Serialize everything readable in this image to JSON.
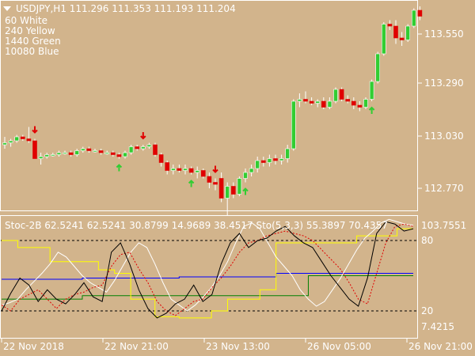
{
  "main_window": {
    "symbol_line": "USDJPY,H1  111.296 111.353 111.193 111.204",
    "legend_lines": [
      "60 White",
      "240 Yellow",
      "1440 Green",
      "10080 Blue"
    ],
    "price_ticks": [
      "113.550",
      "113.290",
      "113.030",
      "112.770"
    ]
  },
  "indicator_window": {
    "header": "Stoc-2B 62.5241 62.5241 30.8799 14.9689 38.4517  Sto(5,3,3) 55.3897 70.4357",
    "scale_top": "103.7551",
    "level_80": "80",
    "level_20": "20",
    "scale_bottom": "7.4215"
  },
  "time_axis": [
    "22 Nov 2018",
    "22 Nov 21:00",
    "23 Nov 13:00",
    "26 Nov 05:00",
    "26 Nov 21:00"
  ],
  "colors": {
    "background": "#d2b48c",
    "bull": "#32cd32",
    "bear": "#e00000",
    "wick": "#ffffff",
    "stoc_main": "#000000",
    "stoc_signal": "#e00000",
    "tf_60": "#ffffff",
    "tf_240": "#ffff00",
    "tf_1440": "#008000",
    "tf_10080": "#0000ff"
  },
  "signals": {
    "sell_arrow_icon": "red-down-arrow",
    "buy_arrow_icon": "green-up-arrow"
  },
  "chart_data": [
    {
      "type": "candlestick",
      "title": "USDJPY,H1",
      "y_ticks": [
        113.55,
        113.29,
        113.03,
        112.77
      ],
      "ylim": [
        112.62,
        113.79
      ],
      "bars": [
        {
          "o": 112.99,
          "h": 113.03,
          "l": 112.97,
          "c": 113.0
        },
        {
          "o": 113.0,
          "h": 113.02,
          "l": 112.98,
          "c": 113.01
        },
        {
          "o": 113.01,
          "h": 113.04,
          "l": 113.0,
          "c": 113.03
        },
        {
          "o": 113.03,
          "h": 113.04,
          "l": 113.01,
          "c": 113.02
        },
        {
          "o": 113.02,
          "h": 113.08,
          "l": 113.0,
          "c": 113.01
        },
        {
          "o": 113.01,
          "h": 113.02,
          "l": 112.92,
          "c": 112.92
        },
        {
          "o": 112.92,
          "h": 112.95,
          "l": 112.89,
          "c": 112.93
        },
        {
          "o": 112.93,
          "h": 112.95,
          "l": 112.92,
          "c": 112.94
        },
        {
          "o": 112.94,
          "h": 112.95,
          "l": 112.93,
          "c": 112.94
        },
        {
          "o": 112.94,
          "h": 112.96,
          "l": 112.93,
          "c": 112.95
        },
        {
          "o": 112.95,
          "h": 112.96,
          "l": 112.94,
          "c": 112.95
        },
        {
          "o": 112.95,
          "h": 112.96,
          "l": 112.93,
          "c": 112.94
        },
        {
          "o": 112.94,
          "h": 112.97,
          "l": 112.93,
          "c": 112.96
        },
        {
          "o": 112.96,
          "h": 112.98,
          "l": 112.95,
          "c": 112.97
        },
        {
          "o": 112.97,
          "h": 112.98,
          "l": 112.95,
          "c": 112.96
        },
        {
          "o": 112.96,
          "h": 112.97,
          "l": 112.95,
          "c": 112.96
        },
        {
          "o": 112.96,
          "h": 112.97,
          "l": 112.94,
          "c": 112.95
        },
        {
          "o": 112.95,
          "h": 112.96,
          "l": 112.94,
          "c": 112.95
        },
        {
          "o": 112.95,
          "h": 112.96,
          "l": 112.93,
          "c": 112.94
        },
        {
          "o": 112.94,
          "h": 112.95,
          "l": 112.92,
          "c": 112.93
        },
        {
          "o": 112.93,
          "h": 112.96,
          "l": 112.92,
          "c": 112.95
        },
        {
          "o": 112.95,
          "h": 112.99,
          "l": 112.94,
          "c": 112.98
        },
        {
          "o": 112.98,
          "h": 112.99,
          "l": 112.96,
          "c": 112.97
        },
        {
          "o": 112.97,
          "h": 112.99,
          "l": 112.96,
          "c": 112.98
        },
        {
          "o": 112.98,
          "h": 113.0,
          "l": 112.97,
          "c": 112.99
        },
        {
          "o": 112.99,
          "h": 113.0,
          "l": 112.93,
          "c": 112.94
        },
        {
          "o": 112.94,
          "h": 112.95,
          "l": 112.88,
          "c": 112.9
        },
        {
          "o": 112.9,
          "h": 112.91,
          "l": 112.84,
          "c": 112.86
        },
        {
          "o": 112.86,
          "h": 112.89,
          "l": 112.84,
          "c": 112.87
        },
        {
          "o": 112.87,
          "h": 112.89,
          "l": 112.85,
          "c": 112.86
        },
        {
          "o": 112.86,
          "h": 112.89,
          "l": 112.84,
          "c": 112.87
        },
        {
          "o": 112.87,
          "h": 112.88,
          "l": 112.84,
          "c": 112.85
        },
        {
          "o": 112.85,
          "h": 112.88,
          "l": 112.82,
          "c": 112.86
        },
        {
          "o": 112.86,
          "h": 112.87,
          "l": 112.82,
          "c": 112.83
        },
        {
          "o": 112.83,
          "h": 112.85,
          "l": 112.77,
          "c": 112.8
        },
        {
          "o": 112.8,
          "h": 112.82,
          "l": 112.76,
          "c": 112.79
        },
        {
          "o": 112.82,
          "h": 112.85,
          "l": 112.7,
          "c": 112.72
        },
        {
          "o": 112.72,
          "h": 112.8,
          "l": 112.63,
          "c": 112.78
        },
        {
          "o": 112.78,
          "h": 112.8,
          "l": 112.72,
          "c": 112.74
        },
        {
          "o": 112.74,
          "h": 112.83,
          "l": 112.73,
          "c": 112.82
        },
        {
          "o": 112.82,
          "h": 112.87,
          "l": 112.8,
          "c": 112.85
        },
        {
          "o": 112.85,
          "h": 112.89,
          "l": 112.83,
          "c": 112.87
        },
        {
          "o": 112.87,
          "h": 112.93,
          "l": 112.85,
          "c": 112.91
        },
        {
          "o": 112.91,
          "h": 112.93,
          "l": 112.88,
          "c": 112.9
        },
        {
          "o": 112.9,
          "h": 112.94,
          "l": 112.88,
          "c": 112.92
        },
        {
          "o": 112.92,
          "h": 112.94,
          "l": 112.89,
          "c": 112.91
        },
        {
          "o": 112.91,
          "h": 112.94,
          "l": 112.89,
          "c": 112.92
        },
        {
          "o": 112.92,
          "h": 112.99,
          "l": 112.9,
          "c": 112.97
        },
        {
          "o": 112.97,
          "h": 113.22,
          "l": 112.96,
          "c": 113.21
        },
        {
          "o": 113.21,
          "h": 113.25,
          "l": 113.18,
          "c": 113.22
        },
        {
          "o": 113.22,
          "h": 113.26,
          "l": 113.2,
          "c": 113.21
        },
        {
          "o": 113.21,
          "h": 113.23,
          "l": 113.19,
          "c": 113.2
        },
        {
          "o": 113.2,
          "h": 113.22,
          "l": 113.18,
          "c": 113.21
        },
        {
          "o": 113.21,
          "h": 113.23,
          "l": 113.17,
          "c": 113.18
        },
        {
          "o": 113.18,
          "h": 113.23,
          "l": 113.17,
          "c": 113.21
        },
        {
          "o": 113.21,
          "h": 113.28,
          "l": 113.2,
          "c": 113.27
        },
        {
          "o": 113.27,
          "h": 113.28,
          "l": 113.21,
          "c": 113.22
        },
        {
          "o": 113.22,
          "h": 113.24,
          "l": 113.2,
          "c": 113.21
        },
        {
          "o": 113.21,
          "h": 113.23,
          "l": 113.17,
          "c": 113.19
        },
        {
          "o": 113.19,
          "h": 113.21,
          "l": 113.16,
          "c": 113.18
        },
        {
          "o": 113.18,
          "h": 113.23,
          "l": 113.17,
          "c": 113.22
        },
        {
          "o": 113.22,
          "h": 113.32,
          "l": 113.21,
          "c": 113.31
        },
        {
          "o": 113.31,
          "h": 113.46,
          "l": 113.3,
          "c": 113.45
        },
        {
          "o": 113.45,
          "h": 113.61,
          "l": 113.44,
          "c": 113.6
        },
        {
          "o": 113.6,
          "h": 113.62,
          "l": 113.57,
          "c": 113.59
        },
        {
          "o": 113.59,
          "h": 113.62,
          "l": 113.5,
          "c": 113.53
        },
        {
          "o": 113.53,
          "h": 113.56,
          "l": 113.49,
          "c": 113.52
        },
        {
          "o": 113.52,
          "h": 113.6,
          "l": 113.51,
          "c": 113.59
        },
        {
          "o": 113.59,
          "h": 113.68,
          "l": 113.58,
          "c": 113.67
        },
        {
          "o": 113.67,
          "h": 113.69,
          "l": 113.62,
          "c": 113.64
        }
      ],
      "sell_signal_bars": [
        5,
        23,
        35
      ],
      "buy_signal_bars": [
        19,
        31,
        40,
        61
      ]
    },
    {
      "type": "line",
      "title": "Stoc-2B / Sto(5,3,3)",
      "ylim": [
        7.4215,
        103.7551
      ],
      "levels": [
        80,
        20
      ],
      "series": [
        {
          "name": "60",
          "values": [
            25,
            27,
            30,
            38,
            45,
            52,
            60,
            70,
            66,
            58,
            50,
            44,
            40,
            36,
            46,
            58,
            70,
            78,
            74,
            60,
            44,
            30,
            25,
            20,
            25,
            32,
            40,
            50,
            62,
            78,
            92,
            95,
            90,
            78,
            66,
            58,
            50,
            38,
            30,
            24,
            28,
            38,
            48,
            60,
            72,
            82,
            88,
            95,
            98,
            96,
            94,
            93
          ]
        },
        {
          "name": "240",
          "values": [
            80,
            80,
            74,
            74,
            74,
            74,
            62,
            62,
            62,
            62,
            62,
            62,
            55,
            55,
            52,
            52,
            30,
            30,
            30,
            15,
            15,
            15,
            14,
            14,
            14,
            14,
            20,
            20,
            30,
            30,
            30,
            30,
            38,
            38,
            78,
            78,
            78,
            78,
            78,
            78,
            78,
            78,
            78,
            78,
            84,
            84,
            84,
            84,
            84,
            90,
            90,
            90
          ]
        },
        {
          "name": "1440",
          "values": [
            30,
            30,
            30,
            30,
            30,
            30,
            30,
            30,
            30,
            30,
            33,
            33,
            33,
            33,
            33,
            33,
            33,
            33,
            33,
            33,
            33,
            33,
            33,
            33,
            33,
            33,
            33,
            33,
            33,
            33,
            33,
            33,
            33,
            33,
            33,
            33,
            33,
            33,
            50,
            50,
            50,
            50,
            50,
            50,
            50,
            50,
            50,
            50,
            50,
            50,
            50,
            50
          ]
        },
        {
          "name": "10080",
          "values": [
            47,
            47,
            47,
            47,
            47,
            47,
            47,
            47,
            47,
            47,
            48,
            48,
            48,
            48,
            48,
            48,
            48,
            48,
            48,
            48,
            48,
            48,
            49,
            49,
            49,
            49,
            49,
            49,
            49,
            49,
            49,
            49,
            49,
            49,
            52,
            52,
            52,
            52,
            52,
            52,
            52,
            52,
            52,
            52,
            52,
            52,
            52,
            52,
            52,
            52,
            52,
            52
          ]
        },
        {
          "name": "Sto main",
          "values": [
            20,
            35,
            48,
            42,
            28,
            38,
            30,
            26,
            34,
            44,
            32,
            28,
            70,
            78,
            60,
            38,
            22,
            14,
            18,
            26,
            30,
            42,
            28,
            34,
            60,
            78,
            86,
            74,
            80,
            82,
            88,
            92,
            84,
            78,
            74,
            62,
            50,
            40,
            30,
            24,
            48,
            86,
            96,
            94,
            88,
            90
          ]
        },
        {
          "name": "Sto signal",
          "values": [
            25,
            20,
            30,
            34,
            38,
            30,
            22,
            30,
            34,
            36,
            40,
            42,
            58,
            68,
            70,
            56,
            44,
            28,
            20,
            16,
            22,
            28,
            30,
            40,
            48,
            58,
            70,
            78,
            80,
            84,
            86,
            88,
            86,
            84,
            80,
            72,
            64,
            56,
            44,
            30,
            26,
            52,
            78,
            92,
            94,
            92
          ]
        }
      ]
    }
  ]
}
